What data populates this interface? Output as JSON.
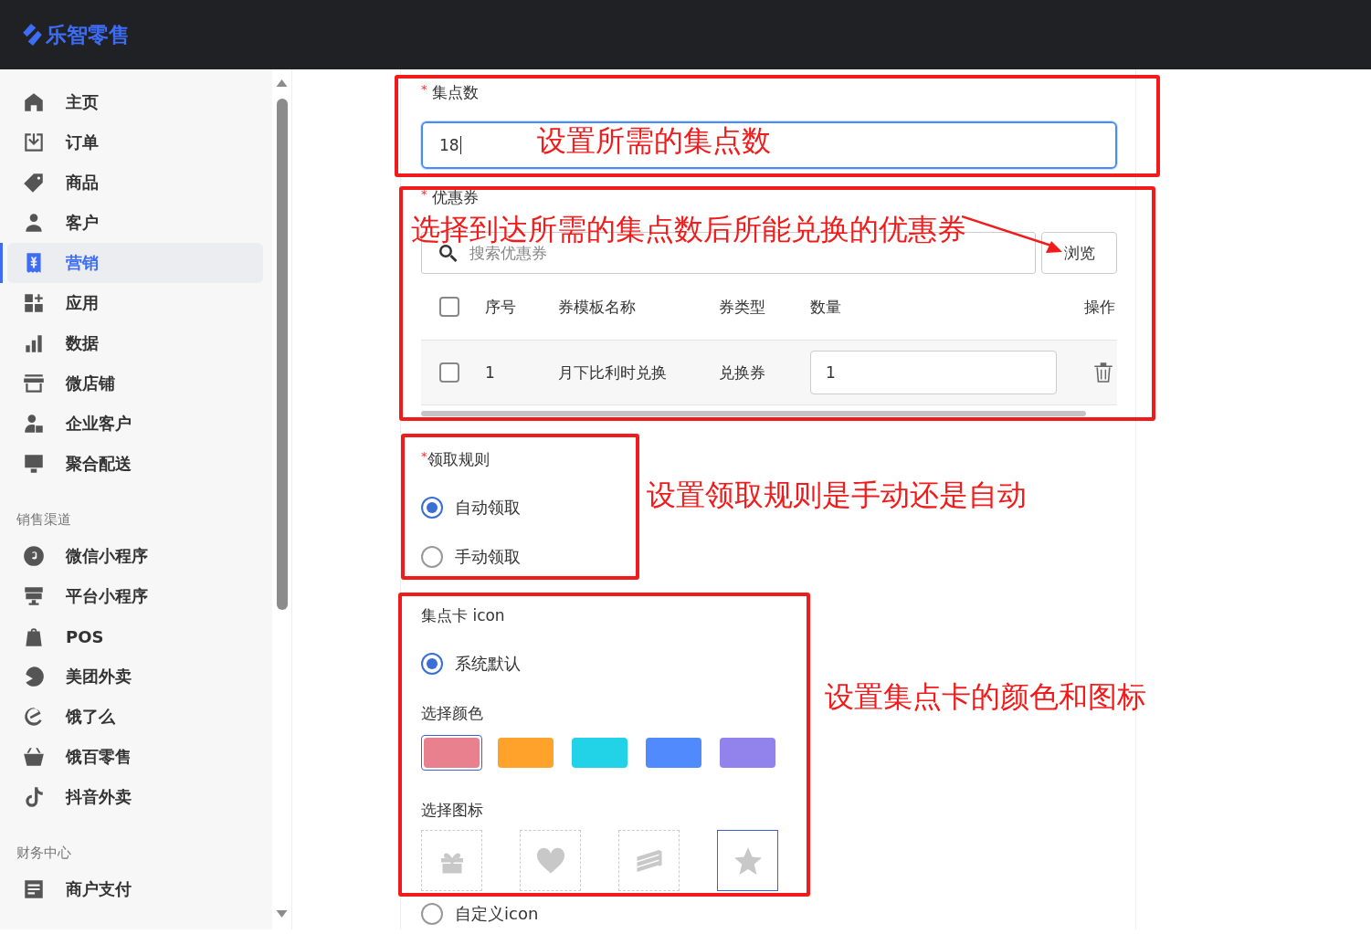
{
  "header": {
    "logo": "乐智零售"
  },
  "sidebar": {
    "sections": [
      {
        "items": [
          {
            "label": "主页",
            "selected": false
          },
          {
            "label": "订单",
            "selected": false
          },
          {
            "label": "商品",
            "selected": false
          },
          {
            "label": "客户",
            "selected": false
          },
          {
            "label": "营销",
            "selected": true
          },
          {
            "label": "应用",
            "selected": false
          },
          {
            "label": "数据",
            "selected": false
          },
          {
            "label": "微店铺",
            "selected": false
          },
          {
            "label": "企业客户",
            "selected": false
          },
          {
            "label": "聚合配送",
            "selected": false
          }
        ]
      },
      {
        "heading": "销售渠道",
        "items": [
          {
            "label": "微信小程序",
            "selected": false
          },
          {
            "label": "平台小程序",
            "selected": false
          },
          {
            "label": "POS",
            "selected": false
          },
          {
            "label": "美团外卖",
            "selected": false
          },
          {
            "label": "饿了么",
            "selected": false
          },
          {
            "label": "饿百零售",
            "selected": false
          },
          {
            "label": "抖音外卖",
            "selected": false
          }
        ]
      },
      {
        "heading": "财务中心",
        "items": [
          {
            "label": "商户支付",
            "selected": false
          }
        ]
      }
    ]
  },
  "form": {
    "stamp_count": {
      "label": "集点数",
      "required_mark": "*",
      "value": "18",
      "focused": true
    },
    "coupon": {
      "label": "优惠券",
      "required_mark": "*",
      "search_placeholder": "搜索优惠券",
      "browse_button": "浏览",
      "header_checked": false,
      "columns": [
        "序号",
        "券模板名称",
        "券类型",
        "数量",
        "操作"
      ],
      "rows": [
        {
          "checked": false,
          "index": "1",
          "name": "月下比利时兑换",
          "type": "兑换券",
          "quantity": "1"
        }
      ]
    },
    "claim_rule": {
      "label": "领取规则",
      "required_mark": "*",
      "options": [
        {
          "label": "自动领取",
          "selected": true
        },
        {
          "label": "手动领取",
          "selected": false
        }
      ]
    },
    "card_icon": {
      "label": "集点卡 icon",
      "options": [
        {
          "label": "系统默认",
          "selected": true
        },
        {
          "label": "自定义icon",
          "selected": false
        }
      ],
      "color_label": "选择颜色",
      "colors": [
        {
          "color": "#e8808d",
          "selected": true
        },
        {
          "color": "#fea22b",
          "selected": false
        },
        {
          "color": "#22d2e6",
          "selected": false
        },
        {
          "color": "#508afd",
          "selected": false
        },
        {
          "color": "#9282eb",
          "selected": false
        }
      ],
      "icon_label": "选择图标",
      "icons": [
        {
          "selected": false
        },
        {
          "selected": false
        },
        {
          "selected": false
        },
        {
          "selected": true
        }
      ]
    }
  },
  "annotations": [
    {
      "text": "设置所需的集点数"
    },
    {
      "text": "选择到达所需的集点数后所能兑换的优惠券"
    },
    {
      "text": "设置领取规则是手动还是自动"
    },
    {
      "text": "设置集点卡的颜色和图标"
    }
  ]
}
